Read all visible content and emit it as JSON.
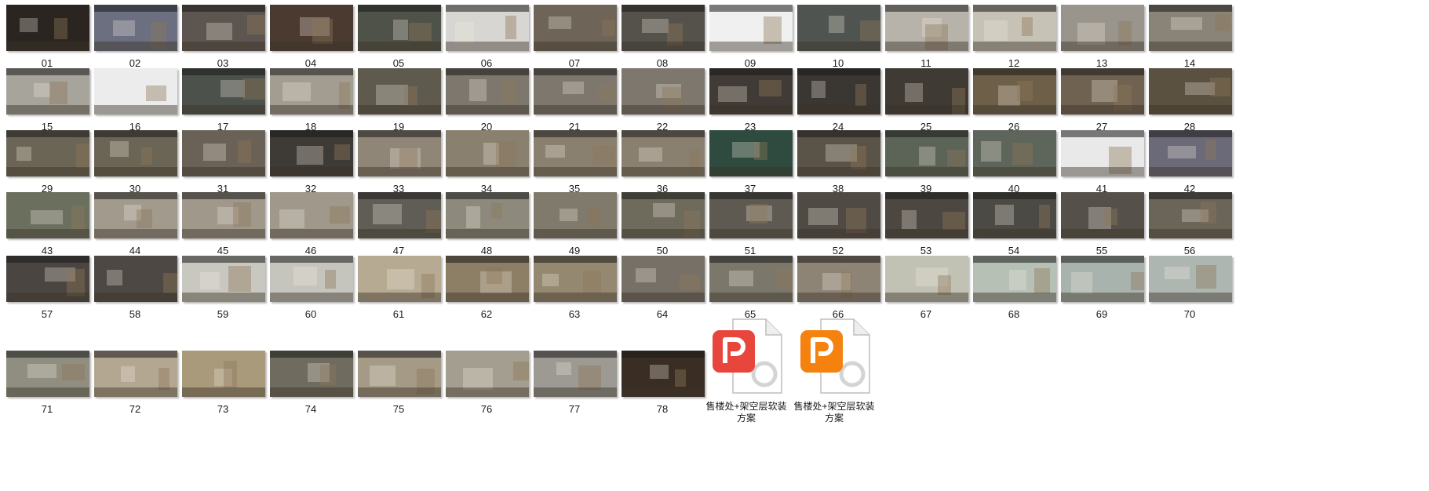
{
  "explorer": {
    "thumbnails": [
      {
        "label": "01",
        "tone": "#2a2520"
      },
      {
        "label": "02",
        "tone": "#6b6f80"
      },
      {
        "label": "03",
        "tone": "#5d5650"
      },
      {
        "label": "04",
        "tone": "#4a3a30"
      },
      {
        "label": "05",
        "tone": "#4f5248"
      },
      {
        "label": "06",
        "tone": "#d8d6d2"
      },
      {
        "label": "07",
        "tone": "#6e6458"
      },
      {
        "label": "08",
        "tone": "#55524b"
      },
      {
        "label": "09",
        "tone": "#f0f0f0"
      },
      {
        "label": "10",
        "tone": "#4f5450"
      },
      {
        "label": "11",
        "tone": "#b8b3aa"
      },
      {
        "label": "12",
        "tone": "#c7c2b6"
      },
      {
        "label": "13",
        "tone": "#9a958c"
      },
      {
        "label": "14",
        "tone": "#8a8478"
      },
      {
        "label": "15",
        "tone": "#a7a49c"
      },
      {
        "label": "16",
        "tone": "#ececec"
      },
      {
        "label": "17",
        "tone": "#4c514b"
      },
      {
        "label": "18",
        "tone": "#a39c90"
      },
      {
        "label": "19",
        "tone": "#5f5a4e"
      },
      {
        "label": "20",
        "tone": "#7d776d"
      },
      {
        "label": "21",
        "tone": "#7d776d"
      },
      {
        "label": "22",
        "tone": "#7d776d"
      },
      {
        "label": "23",
        "tone": "#403b36"
      },
      {
        "label": "24",
        "tone": "#3a3632"
      },
      {
        "label": "25",
        "tone": "#3f3a34"
      },
      {
        "label": "26",
        "tone": "#6e6048"
      },
      {
        "label": "27",
        "tone": "#6f6250"
      },
      {
        "label": "28",
        "tone": "#5b5140"
      },
      {
        "label": "29",
        "tone": "#6b6555"
      },
      {
        "label": "30",
        "tone": "#6b6555"
      },
      {
        "label": "31",
        "tone": "#6a6256"
      },
      {
        "label": "32",
        "tone": "#3e3a35"
      },
      {
        "label": "33",
        "tone": "#8f8677"
      },
      {
        "label": "34",
        "tone": "#8a8070"
      },
      {
        "label": "35",
        "tone": "#8a8070"
      },
      {
        "label": "36",
        "tone": "#8a8070"
      },
      {
        "label": "37",
        "tone": "#2f4a3f"
      },
      {
        "label": "38",
        "tone": "#5a5347"
      },
      {
        "label": "39",
        "tone": "#5c6458"
      },
      {
        "label": "40",
        "tone": "#5e655a"
      },
      {
        "label": "41",
        "tone": "#e9e9e9"
      },
      {
        "label": "42",
        "tone": "#6b6a78"
      },
      {
        "label": "43",
        "tone": "#6b6f5e"
      },
      {
        "label": "44",
        "tone": "#a19a8d"
      },
      {
        "label": "45",
        "tone": "#9f988b"
      },
      {
        "label": "46",
        "tone": "#9f988b"
      },
      {
        "label": "47",
        "tone": "#5f5d55"
      },
      {
        "label": "48",
        "tone": "#8d8a7d"
      },
      {
        "label": "49",
        "tone": "#7f7a6c"
      },
      {
        "label": "50",
        "tone": "#6e6a5c"
      },
      {
        "label": "51",
        "tone": "#5e5a52"
      },
      {
        "label": "52",
        "tone": "#4f4a44"
      },
      {
        "label": "53",
        "tone": "#4c4741"
      },
      {
        "label": "54",
        "tone": "#4b4a44"
      },
      {
        "label": "55",
        "tone": "#55514a"
      },
      {
        "label": "56",
        "tone": "#6a6459"
      },
      {
        "label": "57",
        "tone": "#4a4540"
      },
      {
        "label": "58",
        "tone": "#4d4843"
      },
      {
        "label": "59",
        "tone": "#c8c8c0"
      },
      {
        "label": "60",
        "tone": "#c6c5bd"
      },
      {
        "label": "61",
        "tone": "#b7aa92"
      },
      {
        "label": "62",
        "tone": "#8d7f66"
      },
      {
        "label": "63",
        "tone": "#958870"
      },
      {
        "label": "64",
        "tone": "#777066"
      },
      {
        "label": "65",
        "tone": "#7b786b"
      },
      {
        "label": "66",
        "tone": "#8e8476"
      },
      {
        "label": "67",
        "tone": "#c1c2b4"
      },
      {
        "label": "68",
        "tone": "#b6c0b5"
      },
      {
        "label": "69",
        "tone": "#a9b3ad"
      },
      {
        "label": "70",
        "tone": "#aeb6b2"
      },
      {
        "label": "71",
        "tone": "#8f8e80"
      },
      {
        "label": "72",
        "tone": "#b4a791"
      },
      {
        "label": "73",
        "tone": "#a99a7c"
      },
      {
        "label": "74",
        "tone": "#6f6b5f"
      },
      {
        "label": "75",
        "tone": "#a49a86"
      },
      {
        "label": "76",
        "tone": "#a49e90"
      },
      {
        "label": "77",
        "tone": "#9c9a92"
      },
      {
        "label": "78",
        "tone": "#3a2e24"
      }
    ],
    "files": [
      {
        "name": "售楼处+架空层软装方案",
        "accent": "#e8453c",
        "text_lines": [
          "售楼处+架空层软装",
          "方案"
        ]
      },
      {
        "name": "售楼处+架空层软装方案",
        "accent": "#f5820f",
        "text_lines": [
          "售楼处+架空层软装",
          "方案"
        ]
      }
    ]
  }
}
